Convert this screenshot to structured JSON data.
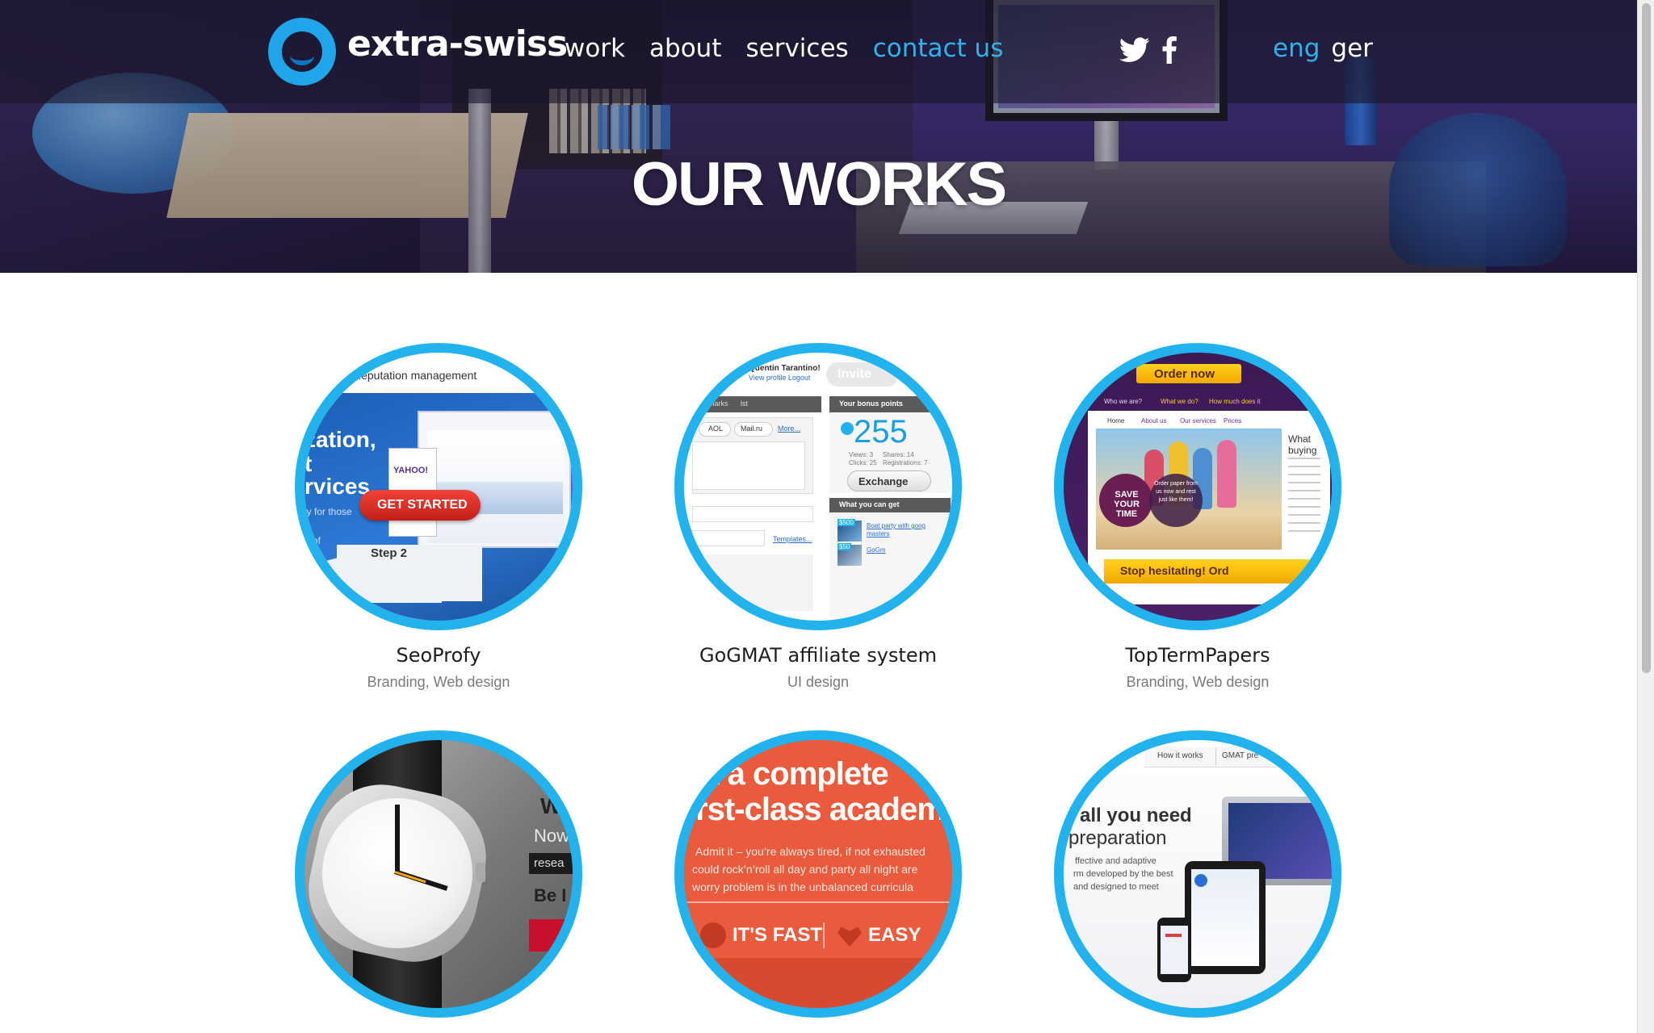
{
  "brand": {
    "name": "extra-swiss",
    "accent": "#22b3ee"
  },
  "nav": {
    "items": [
      {
        "label": "work",
        "active": false
      },
      {
        "label": "about",
        "active": false
      },
      {
        "label": "services",
        "active": false
      },
      {
        "label": "contact us",
        "active": true
      }
    ]
  },
  "social": {
    "icons": [
      "twitter-icon",
      "facebook-icon"
    ]
  },
  "lang": {
    "eng": "eng",
    "ger": "ger",
    "active": "eng"
  },
  "hero": {
    "title": "OUR WORKS"
  },
  "works": [
    {
      "title": "SeoProfy",
      "tags": "Branding, Web design",
      "thumb": {
        "t1": "Reputation management",
        "t2": "zation,",
        "t3": "t",
        "t4": "rvices",
        "t5": "ly for those",
        "t6": "e of",
        "btn": "GET STARTED",
        "step": "Step 2",
        "yahoo": "YAHOO!"
      }
    },
    {
      "title": "GoGMAT affiliate system",
      "tags": "UI design",
      "thumb": {
        "user": "Quentin Tarantino!",
        "links": "View profile  Logout",
        "invite": "Invite",
        "tab1": "marks",
        "tab2": "lst",
        "bonus": "Your bonus points",
        "points": "255",
        "views": "Views: 3",
        "shares": "Shares: 14",
        "clicks": "Clicks: 25",
        "regs": "Registrations: 7",
        "exchange": "Exchange",
        "aol": "AOL",
        "mail": "Mail.ru",
        "more": "More...",
        "templates": "Templates...",
        "can_get": "What you can get",
        "p1": "$500",
        "p2": "$50",
        "l1": "Boat party with goog",
        "l2": "masters",
        "l3": "GoGm"
      }
    },
    {
      "title": "TopTermPapers",
      "tags": "Branding, Web design",
      "thumb": {
        "order": "Order now",
        "n1": "Who we are?",
        "n2": "What we do?",
        "n3": "How much does it",
        "m1": "Home",
        "m2": "About us",
        "m3": "Our services",
        "m4": "Prices",
        "save": "SAVE YOUR TIME",
        "order_text": "Order paper from us now and rest just like them!",
        "what": "What",
        "buying": "buying",
        "stop": "Stop hesitating! Ord"
      }
    },
    {
      "title": "",
      "tags": "",
      "thumb": {
        "w": "W",
        "now": "Now",
        "resea": "resea",
        "be": "Be I"
      }
    },
    {
      "title": "",
      "tags": "",
      "thumb": {
        "h1": "et a complete",
        "h2": "irst-class academ",
        "p1": "Admit it – you’re always tired, if not exhausted",
        "p2": "could rock’n’roll all day and party all night are",
        "p3": "worry problem is in the unbalanced curricula",
        "fast": "IT'S FAST",
        "easy": "EASY"
      }
    },
    {
      "title": "",
      "tags": "",
      "thumb": {
        "nav1": "How it works",
        "nav2": "GMAT pre",
        "h1": "all you need",
        "h2": "preparation",
        "p1": "ffective and adaptive",
        "p2": "rm developed by the best",
        "p3": "and designed to meet"
      }
    }
  ]
}
